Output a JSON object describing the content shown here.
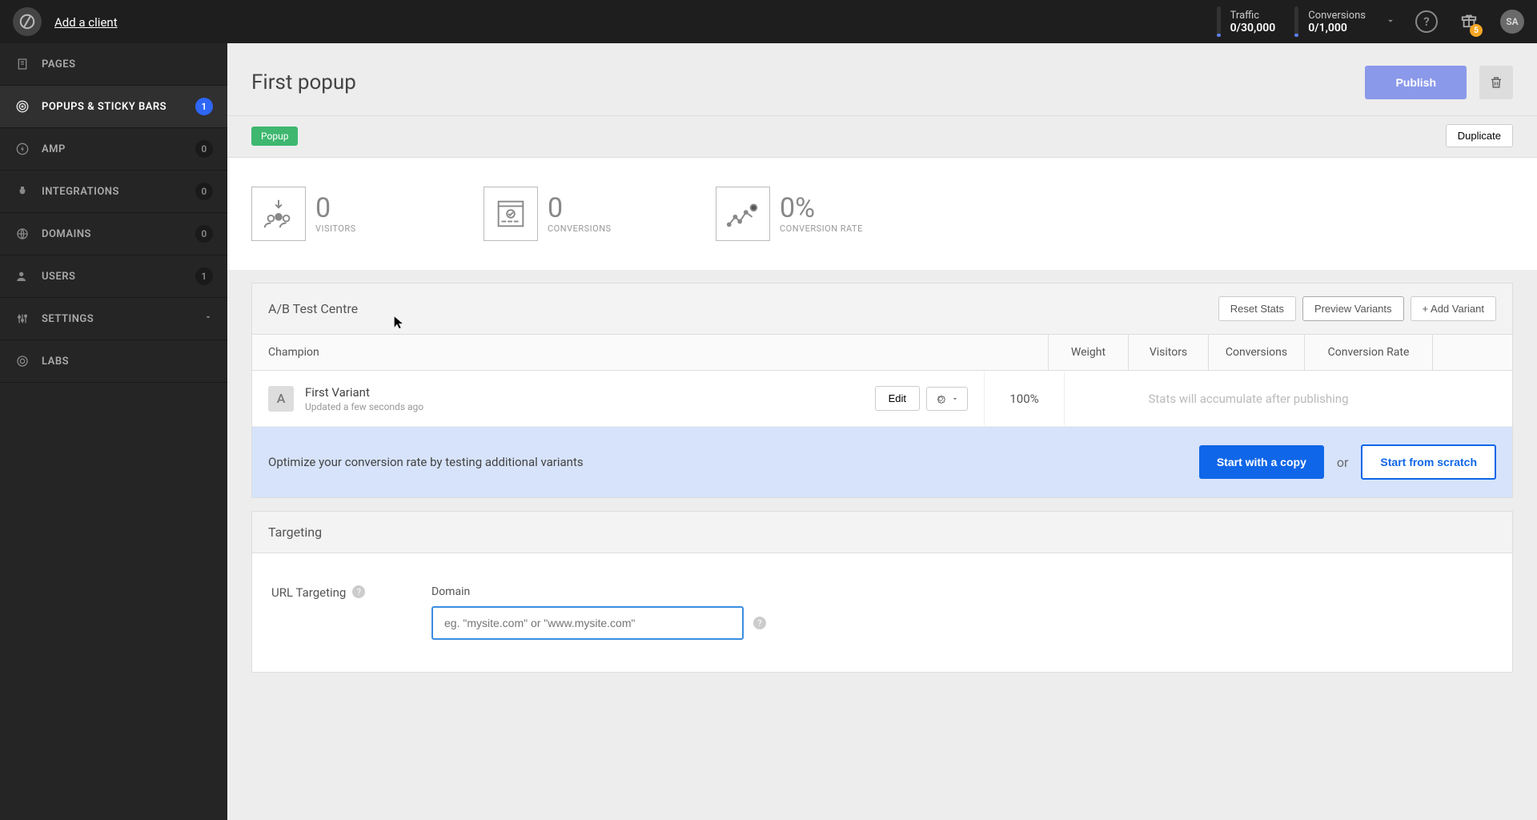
{
  "topbar": {
    "add_client": "Add a client",
    "traffic_label": "Traffic",
    "traffic_value": "0/30,000",
    "conversions_label": "Conversions",
    "conversions_value": "0/1,000",
    "gift_badge": "5",
    "avatar_initials": "SA"
  },
  "sidebar": {
    "items": [
      {
        "label": "PAGES",
        "badge": null,
        "icon": "pages"
      },
      {
        "label": "POPUPS & STICKY BARS",
        "badge": "1",
        "icon": "target",
        "active": true,
        "badge_style": "blue"
      },
      {
        "label": "AMP",
        "badge": "0",
        "icon": "bolt"
      },
      {
        "label": "INTEGRATIONS",
        "badge": "0",
        "icon": "plug"
      },
      {
        "label": "DOMAINS",
        "badge": "0",
        "icon": "globe"
      },
      {
        "label": "USERS",
        "badge": "1",
        "icon": "user"
      },
      {
        "label": "SETTINGS",
        "badge": null,
        "icon": "sliders",
        "chevron": true
      },
      {
        "label": "LABS",
        "badge": null,
        "icon": "flask"
      }
    ]
  },
  "page": {
    "title": "First popup",
    "publish_label": "Publish",
    "popup_tag": "Popup",
    "duplicate_label": "Duplicate"
  },
  "stats": {
    "visitors_num": "0",
    "visitors_label": "VISITORS",
    "conversions_num": "0",
    "conversions_label": "CONVERSIONS",
    "rate_num": "0%",
    "rate_label": "CONVERSION RATE"
  },
  "ab": {
    "title": "A/B Test Centre",
    "reset_label": "Reset Stats",
    "preview_label": "Preview Variants",
    "add_variant_label": "+ Add Variant",
    "cols": {
      "champion": "Champion",
      "weight": "Weight",
      "visitors": "Visitors",
      "conversions": "Conversions",
      "rate": "Conversion Rate"
    },
    "variant": {
      "letter": "A",
      "name": "First Variant",
      "updated": "Updated a few seconds ago",
      "edit_label": "Edit",
      "weight": "100%",
      "pending": "Stats will accumulate after publishing"
    },
    "cta": {
      "text": "Optimize your conversion rate by testing additional variants",
      "copy_label": "Start with a copy",
      "or": "or",
      "scratch_label": "Start from scratch"
    }
  },
  "targeting": {
    "title": "Targeting",
    "url_targeting": "URL Targeting",
    "domain_label": "Domain",
    "domain_placeholder": "eg. \"mysite.com\" or \"www.mysite.com\""
  }
}
